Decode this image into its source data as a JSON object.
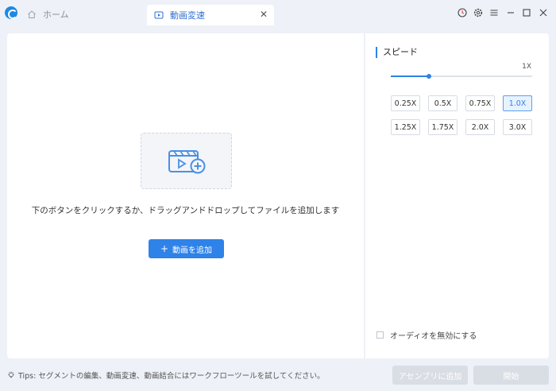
{
  "titlebar": {
    "tabs": [
      {
        "label": "ホーム",
        "icon": "home-icon",
        "active": false
      },
      {
        "label": "動画変速",
        "icon": "video-speed-icon",
        "active": true
      }
    ],
    "controls": [
      "timer-icon",
      "gear-icon",
      "menu-icon",
      "minimize-icon",
      "maximize-icon",
      "close-icon"
    ]
  },
  "main": {
    "drop_hint": "下のボタンをクリックするか、ドラッグアンドドロップしてファイルを追加します",
    "add_button_label": "動画を追加"
  },
  "speed": {
    "title": "スピード",
    "current_value": "1X",
    "slider_fraction": 0.27,
    "options": [
      "0.25X",
      "0.5X",
      "0.75X",
      "1.0X",
      "1.25X",
      "1.75X",
      "2.0X",
      "3.0X"
    ],
    "selected": "1.0X"
  },
  "audio": {
    "disable_label": "オーディオを無効にする",
    "checked": false
  },
  "footer": {
    "tips": "Tips: セグメントの編集、動画変速、動画結合にはワークフローツールを試してください。",
    "add_to_assembly_label": "アセンブリに追加",
    "start_label": "開始"
  },
  "colors": {
    "accent": "#2e82e8",
    "background": "#eef1f7",
    "disabled_button": "#d9dde4"
  }
}
